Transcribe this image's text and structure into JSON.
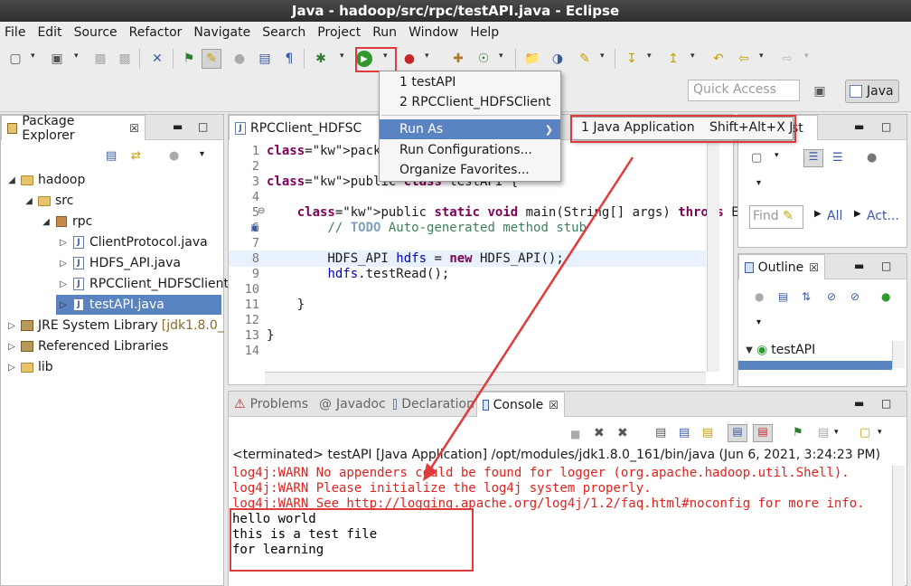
{
  "window": {
    "title": "Java - hadoop/src/rpc/testAPI.java - Eclipse"
  },
  "menubar": [
    "File",
    "Edit",
    "Source",
    "Refactor",
    "Navigate",
    "Search",
    "Project",
    "Run",
    "Window",
    "Help"
  ],
  "toolbar": {
    "quick_access_placeholder": "Quick Access",
    "perspective_label": "Java"
  },
  "package_explorer": {
    "tab_label": "Package Explorer",
    "tree": [
      {
        "label": "hadoop",
        "kind": "project",
        "depth": 0,
        "expanded": true
      },
      {
        "label": "src",
        "kind": "folder",
        "depth": 1,
        "expanded": true
      },
      {
        "label": "rpc",
        "kind": "package",
        "depth": 2,
        "expanded": true
      },
      {
        "label": "ClientProtocol.java",
        "kind": "java",
        "depth": 3
      },
      {
        "label": "HDFS_API.java",
        "kind": "java",
        "depth": 3
      },
      {
        "label": "RPCClient_HDFSClient.j",
        "kind": "java",
        "depth": 3
      },
      {
        "label": "testAPI.java",
        "kind": "java",
        "depth": 3,
        "selected": true
      },
      {
        "label": "JRE System Library",
        "suffix": "[jdk1.8.0_",
        "kind": "lib",
        "depth": 0
      },
      {
        "label": "Referenced Libraries",
        "kind": "lib",
        "depth": 0
      },
      {
        "label": "lib",
        "kind": "folder",
        "depth": 0
      }
    ]
  },
  "editor": {
    "tab_label": "RPCClient_HDFSC",
    "lines": [
      {
        "n": "1",
        "text": "package rpc;"
      },
      {
        "n": "2",
        "text": ""
      },
      {
        "n": "3",
        "text": "public class testAPI {"
      },
      {
        "n": "4",
        "text": ""
      },
      {
        "n": "5",
        "text": "    public static void main(String[] args) throws Exception {"
      },
      {
        "n": "6",
        "text": "        // TODO Auto-generated method stub"
      },
      {
        "n": "7",
        "text": ""
      },
      {
        "n": "8",
        "text": "        HDFS_API hdfs = new HDFS_API();"
      },
      {
        "n": "9",
        "text": "        hdfs.testRead();"
      },
      {
        "n": "10",
        "text": ""
      },
      {
        "n": "11",
        "text": "    }"
      },
      {
        "n": "12",
        "text": ""
      },
      {
        "n": "13",
        "text": "}"
      },
      {
        "n": "14",
        "text": ""
      }
    ]
  },
  "run_dropdown": {
    "items": [
      "1 testAPI",
      "2 RPCClient_HDFSClient",
      "Run As",
      "Run Configurations...",
      "Organize Favorites..."
    ]
  },
  "run_as_submenu": {
    "item_label": "1 Java Application",
    "shortcut": "Shift+Alt+X J"
  },
  "right_top_panel": {
    "tab_fragment": "st",
    "find_placeholder": "Find",
    "all_label": "All",
    "act_label": "Act..."
  },
  "outline": {
    "tab_label": "Outline",
    "root_label": "testAPI"
  },
  "bottom_panel": {
    "tabs": [
      "Problems",
      "Javadoc",
      "Declaration",
      "Console"
    ],
    "console_header": "<terminated> testAPI [Java Application] /opt/modules/jdk1.8.0_161/bin/java (Jun 6, 2021, 3:24:23 PM)",
    "console_lines": [
      {
        "text": "log4j:WARN No appenders could be found for logger (org.apache.hadoop.util.Shell).",
        "color": "#e0231f"
      },
      {
        "text": "log4j:WARN Please initialize the log4j system properly.",
        "color": "#e0231f"
      },
      {
        "text": "log4j:WARN See http://logging.apache.org/log4j/1.2/faq.html#noconfig for more info.",
        "color": "#e0231f"
      },
      {
        "text": "hello world",
        "color": "#000000"
      },
      {
        "text": "this is a test file",
        "color": "#000000"
      },
      {
        "text": "for learning",
        "color": "#000000"
      }
    ]
  }
}
